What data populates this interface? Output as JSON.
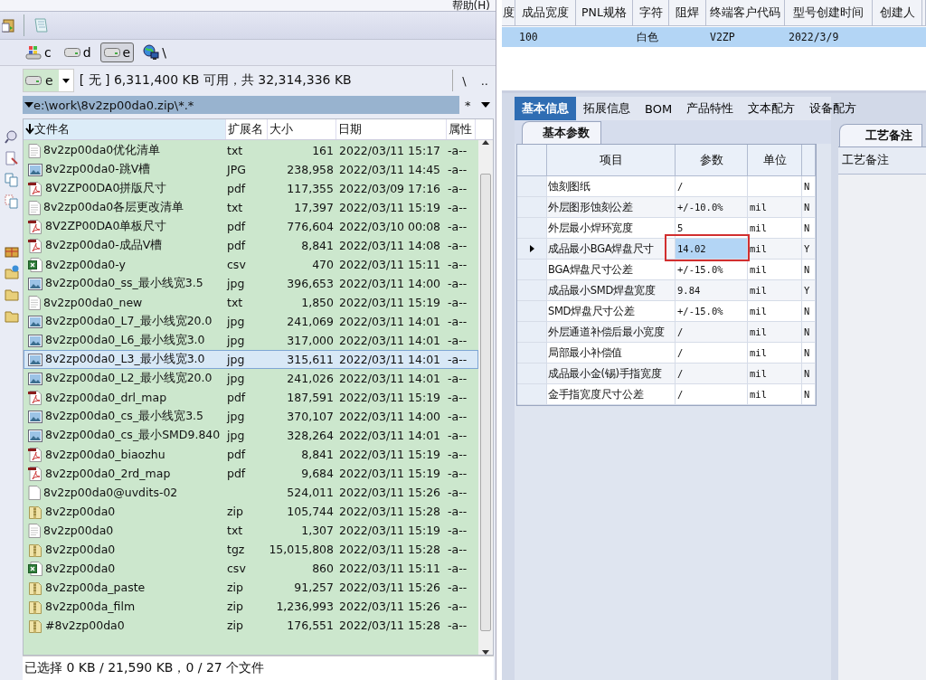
{
  "menu": {
    "help": "帮助(H)"
  },
  "drives": [
    {
      "label": "c",
      "kind": "system",
      "selected": false
    },
    {
      "label": "d",
      "kind": "disk",
      "selected": false
    },
    {
      "label": "e",
      "kind": "disk",
      "selected": true
    },
    {
      "label": "\\",
      "kind": "network",
      "selected": false
    }
  ],
  "drive_bar": {
    "drive": "e",
    "info": "[ 无 ]  6,311,400 KB 可用，共 32,314,336 KB",
    "nav": [
      "\\",
      ".."
    ]
  },
  "path": {
    "value": "e:\\work\\8v2zp00da0.zip\\*.*",
    "filter": "*"
  },
  "columns": [
    "文件名",
    "扩展名",
    "大小",
    "日期",
    "属性"
  ],
  "files": [
    {
      "name": "8v2zp00da0优化清单",
      "ext": "txt",
      "size": "161",
      "date": "2022/03/11 15:17",
      "attr": "-a--",
      "kind": "text",
      "selected": false
    },
    {
      "name": "8v2zp00da0-跳V槽",
      "ext": "JPG",
      "size": "238,958",
      "date": "2022/03/11 14:45",
      "attr": "-a--",
      "kind": "image",
      "selected": false
    },
    {
      "name": "8V2ZP00DA0拼版尺寸",
      "ext": "pdf",
      "size": "117,355",
      "date": "2022/03/09 17:16",
      "attr": "-a--",
      "kind": "pdf",
      "selected": false
    },
    {
      "name": "8v2zp00da0各层更改清单",
      "ext": "txt",
      "size": "17,397",
      "date": "2022/03/11 15:19",
      "attr": "-a--",
      "kind": "text",
      "selected": false
    },
    {
      "name": "8V2ZP00DA0单板尺寸",
      "ext": "pdf",
      "size": "776,604",
      "date": "2022/03/10 00:08",
      "attr": "-a--",
      "kind": "pdf",
      "selected": false
    },
    {
      "name": "8v2zp00da0-成品V槽",
      "ext": "pdf",
      "size": "8,841",
      "date": "2022/03/11 14:08",
      "attr": "-a--",
      "kind": "pdf",
      "selected": false
    },
    {
      "name": "8v2zp00da0-y",
      "ext": "csv",
      "size": "470",
      "date": "2022/03/11 15:11",
      "attr": "-a--",
      "kind": "sheet",
      "selected": false
    },
    {
      "name": "8v2zp00da0_ss_最小线宽3.5",
      "ext": "jpg",
      "size": "396,653",
      "date": "2022/03/11 14:00",
      "attr": "-a--",
      "kind": "image",
      "selected": false
    },
    {
      "name": "8v2zp00da0_new",
      "ext": "txt",
      "size": "1,850",
      "date": "2022/03/11 15:19",
      "attr": "-a--",
      "kind": "text",
      "selected": false
    },
    {
      "name": "8v2zp00da0_L7_最小线宽20.0",
      "ext": "jpg",
      "size": "241,069",
      "date": "2022/03/11 14:01",
      "attr": "-a--",
      "kind": "image",
      "selected": false
    },
    {
      "name": "8v2zp00da0_L6_最小线宽3.0",
      "ext": "jpg",
      "size": "317,000",
      "date": "2022/03/11 14:01",
      "attr": "-a--",
      "kind": "image",
      "selected": false
    },
    {
      "name": "8v2zp00da0_L3_最小线宽3.0",
      "ext": "jpg",
      "size": "315,611",
      "date": "2022/03/11 14:01",
      "attr": "-a--",
      "kind": "image",
      "selected": true
    },
    {
      "name": "8v2zp00da0_L2_最小线宽20.0",
      "ext": "jpg",
      "size": "241,026",
      "date": "2022/03/11 14:01",
      "attr": "-a--",
      "kind": "image",
      "selected": false
    },
    {
      "name": "8v2zp00da0_drl_map",
      "ext": "pdf",
      "size": "187,591",
      "date": "2022/03/11 15:19",
      "attr": "-a--",
      "kind": "pdf",
      "selected": false
    },
    {
      "name": "8v2zp00da0_cs_最小线宽3.5",
      "ext": "jpg",
      "size": "370,107",
      "date": "2022/03/11 14:00",
      "attr": "-a--",
      "kind": "image",
      "selected": false
    },
    {
      "name": "8v2zp00da0_cs_最小SMD9.840",
      "ext": "jpg",
      "size": "328,264",
      "date": "2022/03/11 14:01",
      "attr": "-a--",
      "kind": "image",
      "selected": false
    },
    {
      "name": "8v2zp00da0_biaozhu",
      "ext": "pdf",
      "size": "8,841",
      "date": "2022/03/11 15:19",
      "attr": "-a--",
      "kind": "pdf",
      "selected": false
    },
    {
      "name": "8v2zp00da0_2rd_map",
      "ext": "pdf",
      "size": "9,684",
      "date": "2022/03/11 15:19",
      "attr": "-a--",
      "kind": "pdf",
      "selected": false
    },
    {
      "name": "8v2zp00da0@uvdits-02",
      "size": "524,011",
      "date": "2022/03/11 15:26",
      "attr": "-a--",
      "kind": "blank",
      "selected": false
    },
    {
      "name": "8v2zp00da0",
      "ext": "zip",
      "size": "105,744",
      "date": "2022/03/11 15:28",
      "attr": "-a--",
      "kind": "archive",
      "selected": false
    },
    {
      "name": "8v2zp00da0",
      "ext": "txt",
      "size": "1,307",
      "date": "2022/03/11 15:19",
      "attr": "-a--",
      "kind": "text",
      "selected": false
    },
    {
      "name": "8v2zp00da0",
      "ext": "tgz",
      "size": "15,015,808",
      "date": "2022/03/11 15:28",
      "attr": "-a--",
      "kind": "archive",
      "selected": false
    },
    {
      "name": "8v2zp00da0",
      "ext": "csv",
      "size": "860",
      "date": "2022/03/11 15:11",
      "attr": "-a--",
      "kind": "sheet",
      "selected": false
    },
    {
      "name": "8v2zp00da_paste",
      "ext": "zip",
      "size": "91,257",
      "date": "2022/03/11 15:26",
      "attr": "-a--",
      "kind": "archive",
      "selected": false
    },
    {
      "name": "8v2zp00da_film",
      "ext": "zip",
      "size": "1,236,993",
      "date": "2022/03/11 15:26",
      "attr": "-a--",
      "kind": "archive",
      "selected": false
    },
    {
      "name": "#8v2zp00da0",
      "ext": "zip",
      "size": "176,551",
      "date": "2022/03/11 15:28",
      "attr": "-a--",
      "kind": "archive",
      "selected": false
    }
  ],
  "status_bar": "已选择 0 KB / 21,590 KB，0 / 27 个文件",
  "top_table": {
    "columns": [
      "度",
      "成品宽度",
      "PNL规格",
      "字符",
      "阻焊",
      "终端客户代码",
      "型号创建时间",
      "创建人"
    ],
    "rows": [
      {
        "cells": [
          "",
          "100",
          "",
          "白色",
          "",
          "V2ZP",
          "2022/3/9",
          ""
        ],
        "selected": true
      }
    ]
  },
  "tabs": [
    {
      "label": "基本信息",
      "selected": true
    },
    {
      "label": "拓展信息",
      "selected": false
    },
    {
      "label": "BOM",
      "selected": false
    },
    {
      "label": "产品特性",
      "selected": false
    },
    {
      "label": "文本配方",
      "selected": false
    },
    {
      "label": "设备配方",
      "selected": false
    }
  ],
  "sub_tab": "基本参数",
  "params": {
    "columns": [
      "项目",
      "参数",
      "单位"
    ],
    "rows": [
      {
        "item": "蚀刻图纸",
        "value": "/",
        "flag": "N",
        "selected": false,
        "highlighted": false
      },
      {
        "item": "外层图形蚀刻公差",
        "value": "+/-10.0%",
        "unit": "mil",
        "flag": "N",
        "selected": false,
        "highlighted": false
      },
      {
        "item": "外层最小焊环宽度",
        "value": "5",
        "unit": "mil",
        "flag": "N",
        "selected": false,
        "highlighted": false
      },
      {
        "item": "成品最小BGA焊盘尺寸",
        "value": "14.02",
        "unit": "mil",
        "flag": "Y",
        "selected": true,
        "highlighted": true
      },
      {
        "item": "BGA焊盘尺寸公差",
        "value": "+/-15.0%",
        "unit": "mil",
        "flag": "N",
        "selected": false,
        "highlighted": false
      },
      {
        "item": "成品最小SMD焊盘宽度",
        "value": "9.84",
        "unit": "mil",
        "flag": "Y",
        "selected": false,
        "highlighted": false
      },
      {
        "item": "SMD焊盘尺寸公差",
        "value": "+/-15.0%",
        "unit": "mil",
        "flag": "N",
        "selected": false,
        "highlighted": false
      },
      {
        "item": "外层通道补偿后最小宽度",
        "value": "/",
        "unit": "mil",
        "flag": "N",
        "selected": false,
        "highlighted": false
      },
      {
        "item": "局部最小补偿值",
        "value": "/",
        "unit": "mil",
        "flag": "N",
        "selected": false,
        "highlighted": false
      },
      {
        "item": "成品最小金(锡)手指宽度",
        "value": "/",
        "unit": "mil",
        "flag": "N",
        "selected": false,
        "highlighted": false
      },
      {
        "item": "金手指宽度尺寸公差",
        "value": "/",
        "unit": "mil",
        "flag": "N",
        "selected": false,
        "highlighted": false
      }
    ]
  },
  "notes": {
    "tab": "工艺备注",
    "label": "工艺备注"
  }
}
